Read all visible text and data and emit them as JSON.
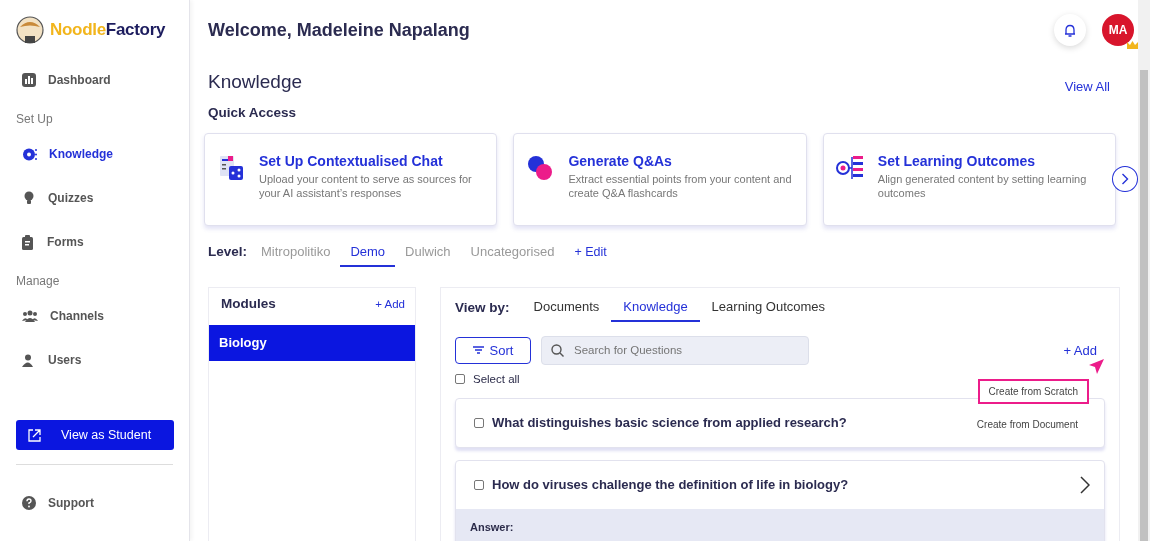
{
  "logo": {
    "part_1": "Noodle",
    "part_2": "Factory"
  },
  "sidebar": [
    {
      "kind": "item",
      "label": "Dashboard",
      "selected": false
    },
    {
      "kind": "heading",
      "label": "Set Up"
    },
    {
      "kind": "item",
      "label": "Knowledge",
      "selected": true
    },
    {
      "kind": "item",
      "label": "Quizzes",
      "selected": false
    },
    {
      "kind": "item",
      "label": "Forms",
      "selected": false
    },
    {
      "kind": "heading",
      "label": "Manage"
    },
    {
      "kind": "item",
      "label": "Channels",
      "selected": false
    },
    {
      "kind": "item",
      "label": "Users",
      "selected": false
    }
  ],
  "view_as_student": "View as Student",
  "support": "Support",
  "header": {
    "welcome": "Welcome, Madeleine Napalang",
    "avatar": "MA"
  },
  "section": {
    "title": "Knowledge",
    "view_all": "View All",
    "subtitle": "Quick Access"
  },
  "quick_access": [
    {
      "title": "Set Up Contextualised Chat",
      "description": "Upload your content to serve as sources for your AI assistant’s responses"
    },
    {
      "title": "Generate Q&As",
      "description": "Extract essential points from your content and create Q&A flashcards"
    },
    {
      "title": "Set Learning Outcomes",
      "description": "Align generated content by setting learning outcomes"
    }
  ],
  "levels": {
    "label": "Level:",
    "tabs": [
      {
        "label": "Mitropolitiko",
        "selected": false
      },
      {
        "label": "Demo",
        "selected": true
      },
      {
        "label": "Dulwich",
        "selected": false
      },
      {
        "label": "Uncategorised",
        "selected": false
      }
    ],
    "edit": "+ Edit"
  },
  "modules": {
    "title": "Modules",
    "add": "+ Add",
    "items": [
      {
        "label": "Biology",
        "selected": true
      }
    ]
  },
  "view_by": {
    "label": "View by:",
    "tabs": [
      {
        "label": "Documents",
        "selected": false
      },
      {
        "label": "Knowledge",
        "selected": true
      },
      {
        "label": "Learning Outcomes",
        "selected": false
      }
    ]
  },
  "toolbar": {
    "sort": "Sort",
    "search_placeholder": "Search for Questions",
    "add": "+ Add"
  },
  "select_all": {
    "label": "Select all",
    "checked": false
  },
  "add_menu": [
    {
      "label": "Create from Scratch",
      "selected": true
    },
    {
      "label": "Create from Document",
      "selected": false
    }
  ],
  "questions": [
    {
      "text": "What distinguishes basic science from applied research?",
      "checked": false
    },
    {
      "text": "How do viruses challenge the definition of life in biology?",
      "checked": false,
      "expanded": true,
      "answer_label": "Answer:"
    }
  ]
}
